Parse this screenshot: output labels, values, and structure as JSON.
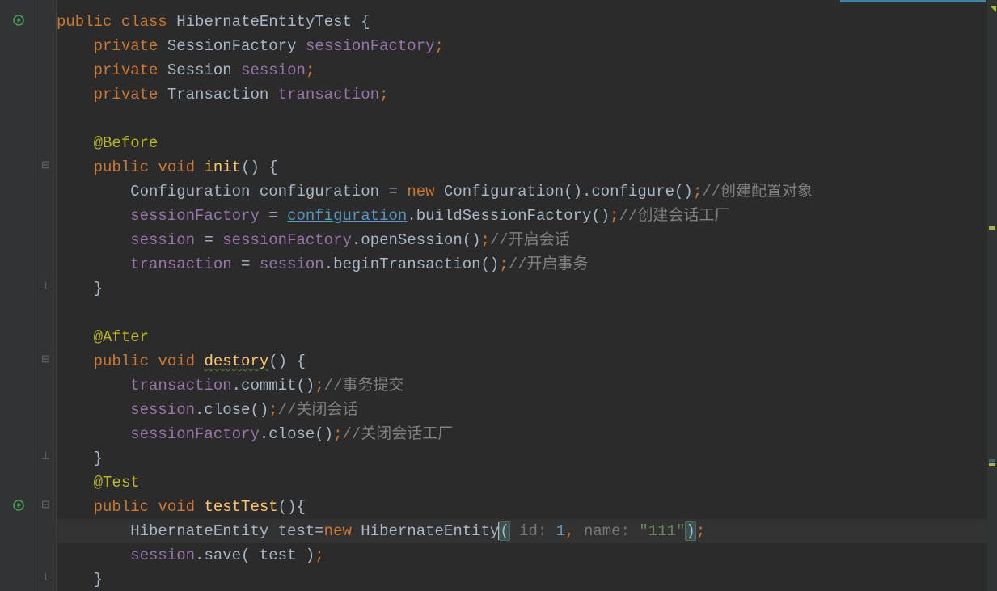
{
  "code": {
    "l1": {
      "public": "public",
      "class": "class",
      "className": "HibernateEntityTest",
      "brace": " {"
    },
    "l2": {
      "indent": "    ",
      "private": "private",
      "type": "SessionFactory",
      "field": "sessionFactory",
      "semi": ";"
    },
    "l3": {
      "indent": "    ",
      "private": "private",
      "type": "Session",
      "field": "session",
      "semi": ";"
    },
    "l4": {
      "indent": "    ",
      "private": "private",
      "type": "Transaction",
      "field": "transaction",
      "semi": ";"
    },
    "l6": {
      "indent": "    ",
      "anno": "@Before"
    },
    "l7": {
      "indent": "    ",
      "public": "public",
      "void": "void",
      "method": "init",
      "parens": "() {"
    },
    "l8": {
      "indent": "        ",
      "type": "Configuration",
      "var": "configuration",
      "eq": " = ",
      "new": "new",
      "type2": "Configuration",
      "call": "().configure()",
      "semi": ";",
      "comment": "//创建配置对象"
    },
    "l9": {
      "indent": "        ",
      "field": "sessionFactory",
      "eq": " = ",
      "var": "configuration",
      "methodCall": ".buildSessionFactory()",
      "semi": ";",
      "comment": "//创建会话工厂"
    },
    "l10": {
      "indent": "        ",
      "field": "session",
      "eq": " = ",
      "field2": "sessionFactory",
      "methodCall": ".openSession()",
      "semi": ";",
      "comment": "//开启会话"
    },
    "l11": {
      "indent": "        ",
      "field": "transaction",
      "eq": " = ",
      "field2": "session",
      "methodCall": ".beginTransaction()",
      "semi": ";",
      "comment": "//开启事务"
    },
    "l12": {
      "indent": "    ",
      "brace": "}"
    },
    "l14": {
      "indent": "    ",
      "anno": "@After"
    },
    "l15": {
      "indent": "    ",
      "public": "public",
      "void": "void",
      "method": "destory",
      "parens": "() {"
    },
    "l16": {
      "indent": "        ",
      "field": "transaction",
      "methodCall": ".commit()",
      "semi": ";",
      "comment": "//事务提交"
    },
    "l17": {
      "indent": "        ",
      "field": "session",
      "methodCall": ".close()",
      "semi": ";",
      "comment": "//关闭会话"
    },
    "l18": {
      "indent": "        ",
      "field": "sessionFactory",
      "methodCall": ".close()",
      "semi": ";",
      "comment": "//关闭会话工厂"
    },
    "l19": {
      "indent": "    ",
      "brace": "}"
    },
    "l20": {
      "indent": "    ",
      "anno": "@Test"
    },
    "l21": {
      "indent": "    ",
      "public": "public",
      "void": "void",
      "method": "testTest",
      "parens": "(){"
    },
    "l22": {
      "indent": "        ",
      "type": "HibernateEntity",
      "var": "test",
      "eq": "=",
      "new": "new",
      "type2": "HibernateEntity",
      "openParen": "(",
      "hint1": " id: ",
      "val1": "1",
      "comma": ",",
      "hint2": " name: ",
      "val2": "\"111\"",
      "closeParen": ")",
      "semi": ";"
    },
    "l23": {
      "indent": "        ",
      "field": "session",
      "methodCall": ".save( test )",
      "semi": ";"
    },
    "l24": {
      "indent": "    ",
      "brace": "}"
    }
  }
}
